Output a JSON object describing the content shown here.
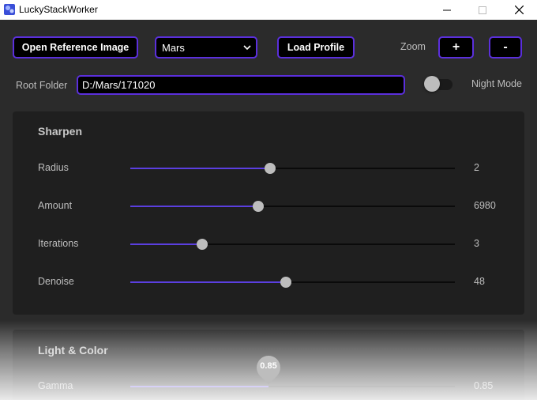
{
  "window": {
    "title": "LuckyStackWorker",
    "controls": {
      "minimize_icon": "minimize-icon",
      "maximize_icon": "maximize-icon",
      "close_icon": "close-icon"
    }
  },
  "toolbar": {
    "open_reference_label": "Open Reference Image",
    "planet_selected": "Mars",
    "load_profile_label": "Load Profile",
    "zoom_label": "Zoom",
    "zoom_in_label": "+",
    "zoom_out_label": "-"
  },
  "root_folder": {
    "label": "Root Folder",
    "value": "D:/Mars/171020"
  },
  "night_mode": {
    "label": "Night Mode",
    "enabled": false
  },
  "sharpen": {
    "title": "Sharpen",
    "sliders": [
      {
        "label": "Radius",
        "value": "2",
        "fraction": 0.43
      },
      {
        "label": "Amount",
        "value": "6980",
        "fraction": 0.395
      },
      {
        "label": "Iterations",
        "value": "3",
        "fraction": 0.222
      },
      {
        "label": "Denoise",
        "value": "48",
        "fraction": 0.48
      }
    ]
  },
  "light_color": {
    "title": "Light & Color",
    "sliders": [
      {
        "label": "Gamma",
        "value": "0.85",
        "tooltip": "0.85",
        "fraction": 0.425
      }
    ]
  },
  "colors": {
    "accent": "#5b2fdc",
    "slider_fill": "#5b3fe0",
    "background": "#2b2b2b",
    "panel": "#1f1f1f",
    "text": "#bdbdbd"
  }
}
